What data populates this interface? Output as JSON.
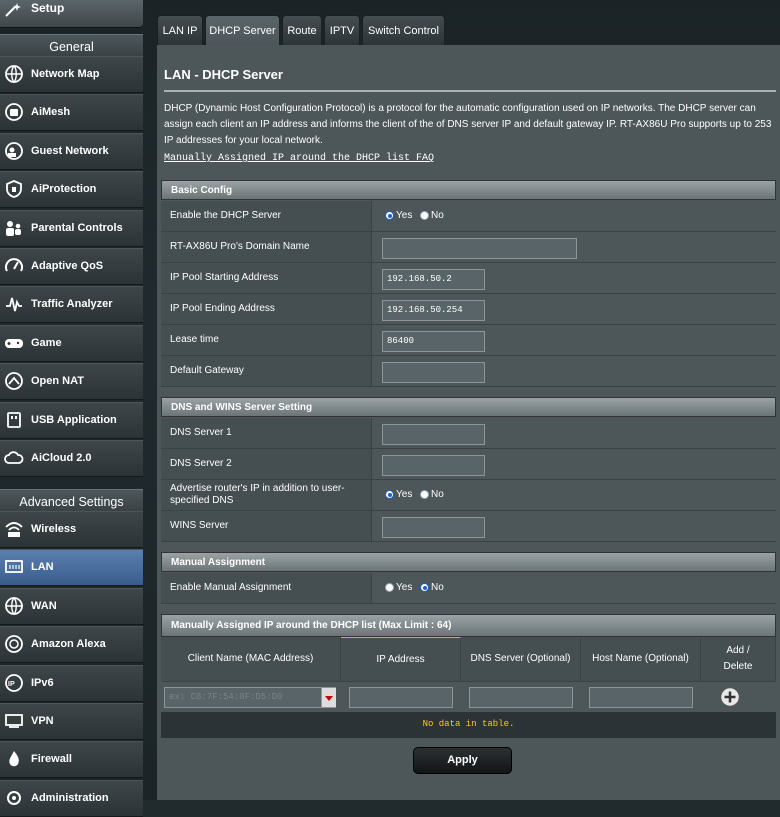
{
  "sidebar": {
    "top_label": "Setup",
    "general_header": "General",
    "general_items": [
      {
        "label": "Network Map",
        "icon": "network-map-icon"
      },
      {
        "label": "AiMesh",
        "icon": "aimesh-icon"
      },
      {
        "label": "Guest Network",
        "icon": "guest-network-icon"
      },
      {
        "label": "AiProtection",
        "icon": "aiprotection-icon"
      },
      {
        "label": "Parental Controls",
        "icon": "parental-controls-icon"
      },
      {
        "label": "Adaptive QoS",
        "icon": "qos-gauge-icon"
      },
      {
        "label": "Traffic Analyzer",
        "icon": "traffic-analyzer-icon"
      },
      {
        "label": "Game",
        "icon": "gamepad-icon"
      },
      {
        "label": "Open NAT",
        "icon": "open-nat-icon"
      },
      {
        "label": "USB Application",
        "icon": "usb-icon"
      },
      {
        "label": "AiCloud 2.0",
        "icon": "cloud-icon"
      }
    ],
    "advanced_header": "Advanced Settings",
    "advanced_items": [
      {
        "label": "Wireless",
        "icon": "wireless-icon"
      },
      {
        "label": "LAN",
        "icon": "lan-icon"
      },
      {
        "label": "WAN",
        "icon": "wan-globe-icon"
      },
      {
        "label": "Amazon Alexa",
        "icon": "alexa-icon"
      },
      {
        "label": "IPv6",
        "icon": "ipv6-icon"
      },
      {
        "label": "VPN",
        "icon": "vpn-icon"
      },
      {
        "label": "Firewall",
        "icon": "firewall-icon"
      },
      {
        "label": "Administration",
        "icon": "administration-icon"
      }
    ],
    "active_item": "LAN"
  },
  "tabs": [
    "LAN IP",
    "DHCP Server",
    "Route",
    "IPTV",
    "Switch Control"
  ],
  "active_tab": "DHCP Server",
  "main": {
    "title": "LAN - DHCP Server",
    "description": "DHCP (Dynamic Host Configuration Protocol) is a protocol for the automatic configuration used on IP networks. The DHCP server can assign each client an IP address and informs the client of the of DNS server IP and default gateway IP. RT-AX86U Pro supports up to 253 IP addresses for your local network.",
    "faq_link": "Manually Assigned IP around the DHCP list FAQ"
  },
  "basic_config": {
    "header": "Basic Config",
    "enable_dhcp_label": "Enable the DHCP Server",
    "enable_dhcp_value": "Yes",
    "domain_label": "RT-AX86U Pro's Domain Name",
    "domain_value": "",
    "pool_start_label": "IP Pool Starting Address",
    "pool_start_value": "192.168.50.2",
    "pool_end_label": "IP Pool Ending Address",
    "pool_end_value": "192.168.50.254",
    "lease_label": "Lease time",
    "lease_value": "86400",
    "gateway_label": "Default Gateway",
    "gateway_value": ""
  },
  "dns_wins": {
    "header": "DNS and WINS Server Setting",
    "dns1_label": "DNS Server 1",
    "dns1_value": "",
    "dns2_label": "DNS Server 2",
    "dns2_value": "",
    "advertise_label": "Advertise router's IP in addition to user-specified DNS",
    "advertise_value": "Yes",
    "wins_label": "WINS Server",
    "wins_value": ""
  },
  "manual_assignment": {
    "header": "Manual Assignment",
    "enable_label": "Enable Manual Assignment",
    "enable_value": "No"
  },
  "radio_labels": {
    "yes": "Yes",
    "no": "No"
  },
  "assigned_table": {
    "header": "Manually Assigned IP around the DHCP list (Max Limit : 64)",
    "columns": [
      "Client Name (MAC Address)",
      "IP Address",
      "DNS Server (Optional)",
      "Host Name (Optional)",
      "Add / Delete"
    ],
    "client_placeholder": "ex: C8:7F:54:8F:D5:D0",
    "empty_message": "No data in table."
  },
  "apply_label": "Apply",
  "colors": {
    "accent": "#ffcc00",
    "active_nav": "#4a6fa0",
    "radio_on": "#1e5fc7"
  }
}
